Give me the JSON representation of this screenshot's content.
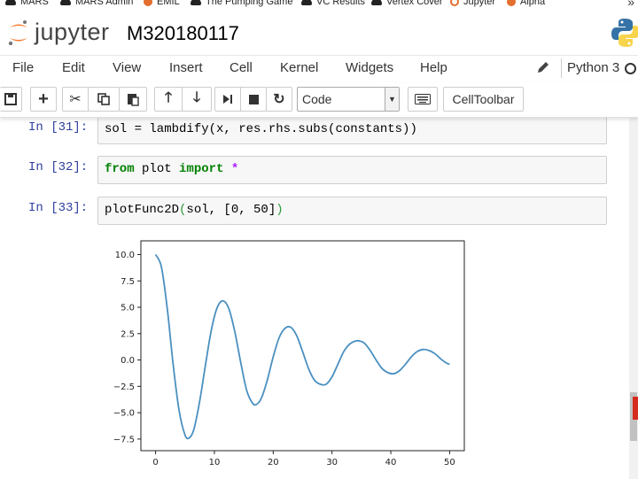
{
  "bookmarks": [
    {
      "label": "MARS",
      "icon": "hat-icon"
    },
    {
      "label": "MARS Admin",
      "icon": "hat-icon"
    },
    {
      "label": "EMIL",
      "icon": "emil-icon"
    },
    {
      "label": "The Pumping Game",
      "icon": "hat-icon"
    },
    {
      "label": "VC Results",
      "icon": "hat-icon"
    },
    {
      "label": "Vertex Cover",
      "icon": "hat-icon"
    },
    {
      "label": "Jupyter",
      "icon": "jupyter-icon"
    },
    {
      "label": "Alpha",
      "icon": "gear-icon"
    }
  ],
  "header": {
    "logo_text": "jupyter",
    "notebook_name": "M320180117"
  },
  "menu": {
    "items": [
      "File",
      "Edit",
      "View",
      "Insert",
      "Cell",
      "Kernel",
      "Widgets",
      "Help"
    ],
    "kernel_name": "Python 3"
  },
  "toolbar": {
    "cell_type": "Code",
    "celltoolbar_label": "CellToolbar"
  },
  "cells": [
    {
      "prompt": "In [31]:",
      "code_plain": "sol = lambdify(x, res.rhs.subs(constants))"
    },
    {
      "prompt": "In [32]:",
      "kw1": "from",
      "mid": " plot ",
      "kw2": "import",
      "star": " *"
    },
    {
      "prompt": "In [33]:",
      "fn": "plotFunc2D",
      "args_open": "(",
      "args": "sol, [0, 50]",
      "args_close": ")"
    }
  ],
  "chart_data": {
    "type": "line",
    "title": "",
    "xlabel": "",
    "ylabel": "",
    "xlim": [
      -2.5,
      52.5
    ],
    "ylim": [
      -8.6,
      11.3
    ],
    "xticks": [
      0,
      10,
      20,
      30,
      40,
      50
    ],
    "yticks": [
      -7.5,
      -5.0,
      -2.5,
      0.0,
      2.5,
      5.0,
      7.5,
      10.0
    ],
    "ytick_labels": [
      "−7.5",
      "−5.0",
      "−2.5",
      "0.0",
      "2.5",
      "5.0",
      "7.5",
      "10.0"
    ],
    "line_color": "#4a90c0",
    "series": [
      {
        "x": [
          0,
          1,
          2,
          3,
          4,
          5,
          5.7,
          6.5,
          7.5,
          8.5,
          9.5,
          10.5,
          11.5,
          12.5,
          13.5,
          14.5,
          15.5,
          16.5,
          17.2,
          18,
          19,
          20,
          21,
          22,
          23,
          24,
          25,
          26,
          27,
          28,
          29,
          30,
          31,
          32,
          33,
          34,
          34.7,
          35.5,
          36.5,
          37.5,
          38.5,
          39.5,
          40.5,
          41.5,
          42.5,
          43.5,
          44.5,
          45.5,
          46.5,
          47.5,
          48.5,
          49.5,
          50
        ],
        "y": [
          10.0,
          8.8,
          4.8,
          -0.5,
          -4.8,
          -7.1,
          -7.4,
          -6.6,
          -3.9,
          -0.4,
          2.9,
          5.0,
          5.6,
          4.8,
          2.6,
          -0.3,
          -2.9,
          -4.1,
          -4.2,
          -3.6,
          -1.9,
          0.3,
          2.1,
          3.0,
          3.1,
          2.3,
          0.8,
          -0.8,
          -1.9,
          -2.3,
          -2.3,
          -1.6,
          -0.4,
          0.8,
          1.5,
          1.8,
          1.8,
          1.6,
          0.9,
          0.0,
          -0.8,
          -1.2,
          -1.3,
          -1.0,
          -0.4,
          0.3,
          0.8,
          1.0,
          0.9,
          0.6,
          0.1,
          -0.3,
          -0.4
        ]
      }
    ]
  }
}
